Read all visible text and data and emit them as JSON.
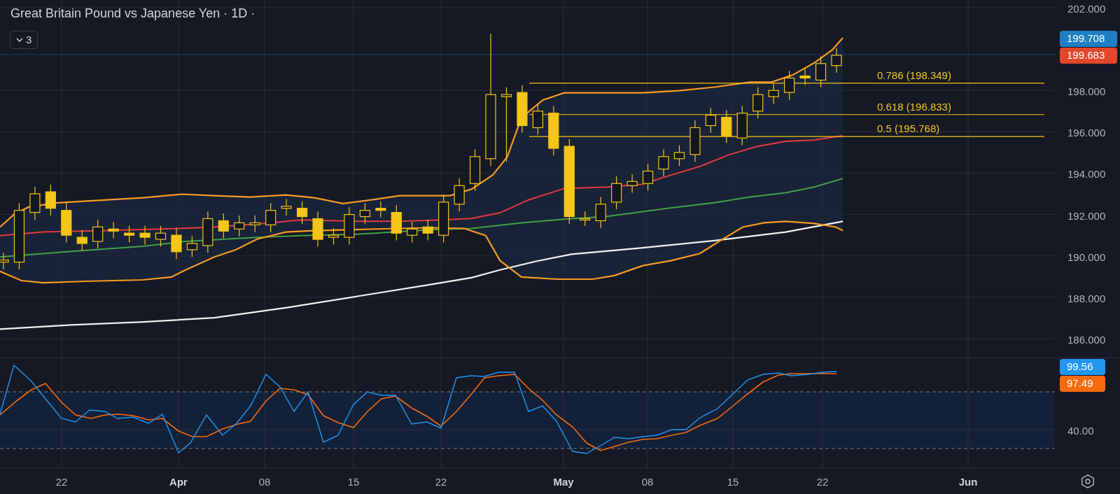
{
  "chart_title": "Great Britain Pound vs Japanese Yen · 1D ·",
  "legend_toggle": {
    "count": "3",
    "expanded": false
  },
  "price_axis": {
    "labels": [
      "202.000",
      "198.000",
      "196.000",
      "194.000",
      "192.000",
      "190.000",
      "188.000",
      "186.000"
    ]
  },
  "price_badges": [
    {
      "label": "199.708",
      "color": "#1e7fc4"
    },
    {
      "label": "199.683",
      "color": "#e0472b"
    }
  ],
  "fib_levels": [
    "0.786 (198.349)",
    "0.618 (196.833)",
    "0.5 (195.768)"
  ],
  "oscillator": {
    "axis_label": "40.00",
    "badges": [
      {
        "label": "99.56",
        "color": "#2196f3"
      },
      {
        "label": "97.49",
        "color": "#f76b0f"
      }
    ]
  },
  "time_axis": [
    {
      "label": "22",
      "kind": "day"
    },
    {
      "label": "Apr",
      "kind": "month"
    },
    {
      "label": "08",
      "kind": "day"
    },
    {
      "label": "15",
      "kind": "day"
    },
    {
      "label": "22",
      "kind": "day"
    },
    {
      "label": "May",
      "kind": "month"
    },
    {
      "label": "08",
      "kind": "day"
    },
    {
      "label": "15",
      "kind": "day"
    },
    {
      "label": "22",
      "kind": "day"
    },
    {
      "label": "Jun",
      "kind": "month"
    }
  ]
}
